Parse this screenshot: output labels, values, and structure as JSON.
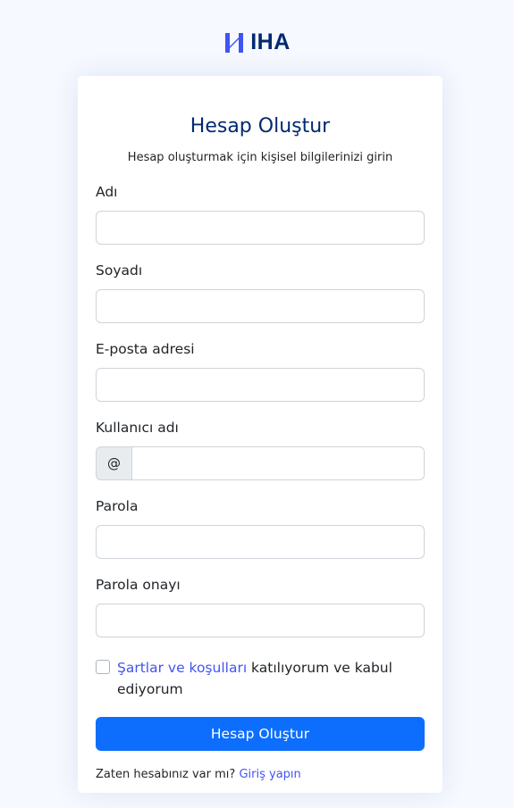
{
  "brand": {
    "name": "IHA",
    "logo_icon": "iha-logo-icon",
    "color": "#012970",
    "accent": "#4154f1"
  },
  "card": {
    "title": "Hesap Oluştur",
    "subtitle": "Hesap oluşturmak için kişisel bilgilerinizi girin"
  },
  "form": {
    "first_name": {
      "label": "Adı",
      "value": "",
      "placeholder": ""
    },
    "last_name": {
      "label": "Soyadı",
      "value": "",
      "placeholder": ""
    },
    "email": {
      "label": "E-posta adresi",
      "value": "",
      "placeholder": ""
    },
    "username": {
      "label": "Kullanıcı adı",
      "prefix": "@",
      "value": "",
      "placeholder": ""
    },
    "password": {
      "label": "Parola",
      "value": "",
      "placeholder": ""
    },
    "password_confirm": {
      "label": "Parola onayı",
      "value": "",
      "placeholder": ""
    },
    "terms": {
      "checked": false,
      "link_text": "Şartlar ve koşulları",
      "rest_text": " katılıyorum ve kabul ediyorum"
    },
    "submit_label": "Hesap Oluştur",
    "submit_color": "#0d6efd"
  },
  "footer": {
    "prompt": "Zaten hesabınız var mı?",
    "login_link": "Giriş yapın"
  }
}
